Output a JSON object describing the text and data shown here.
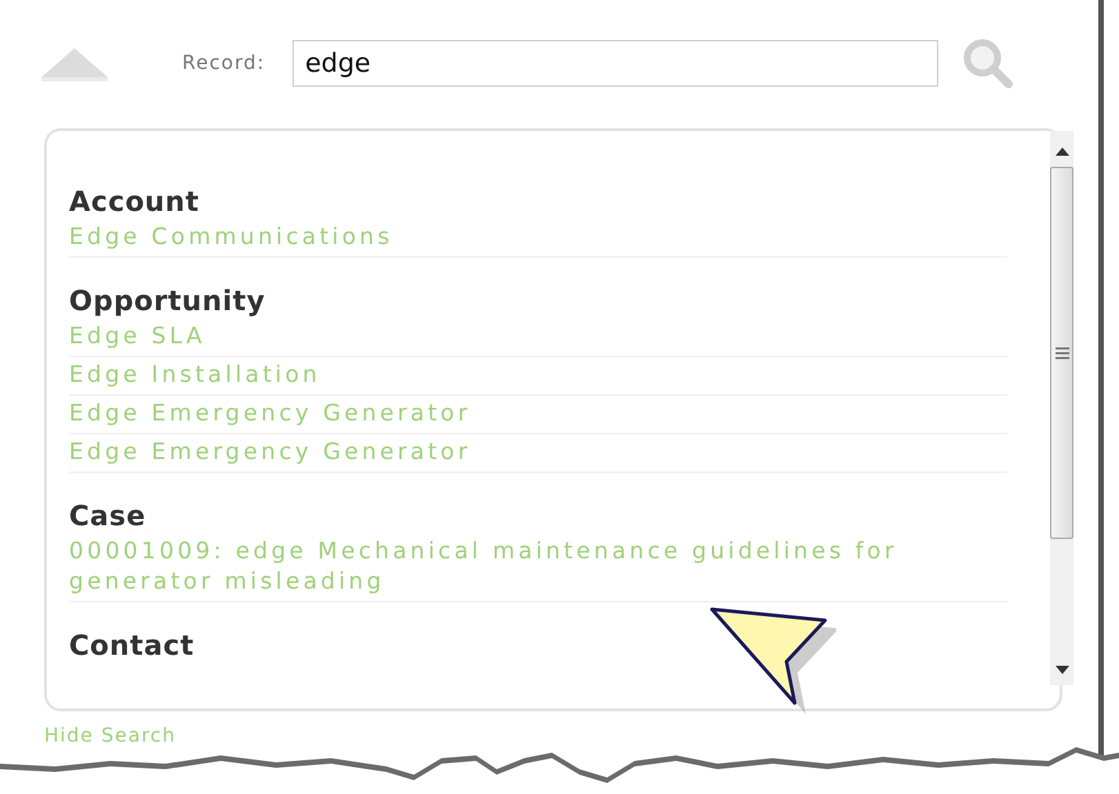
{
  "search": {
    "label": "Record:",
    "value": "edge"
  },
  "results": [
    {
      "heading": "Account",
      "items": [
        "Edge Communications"
      ]
    },
    {
      "heading": "Opportunity",
      "items": [
        "Edge SLA",
        "Edge Installation",
        "Edge Emergency Generator",
        "Edge Emergency Generator"
      ]
    },
    {
      "heading": "Case",
      "items": [
        "00001009: edge Mechanical maintenance guidelines for generator misleading"
      ]
    },
    {
      "heading": "Contact"
    }
  ],
  "footer_link": "Hide Search"
}
